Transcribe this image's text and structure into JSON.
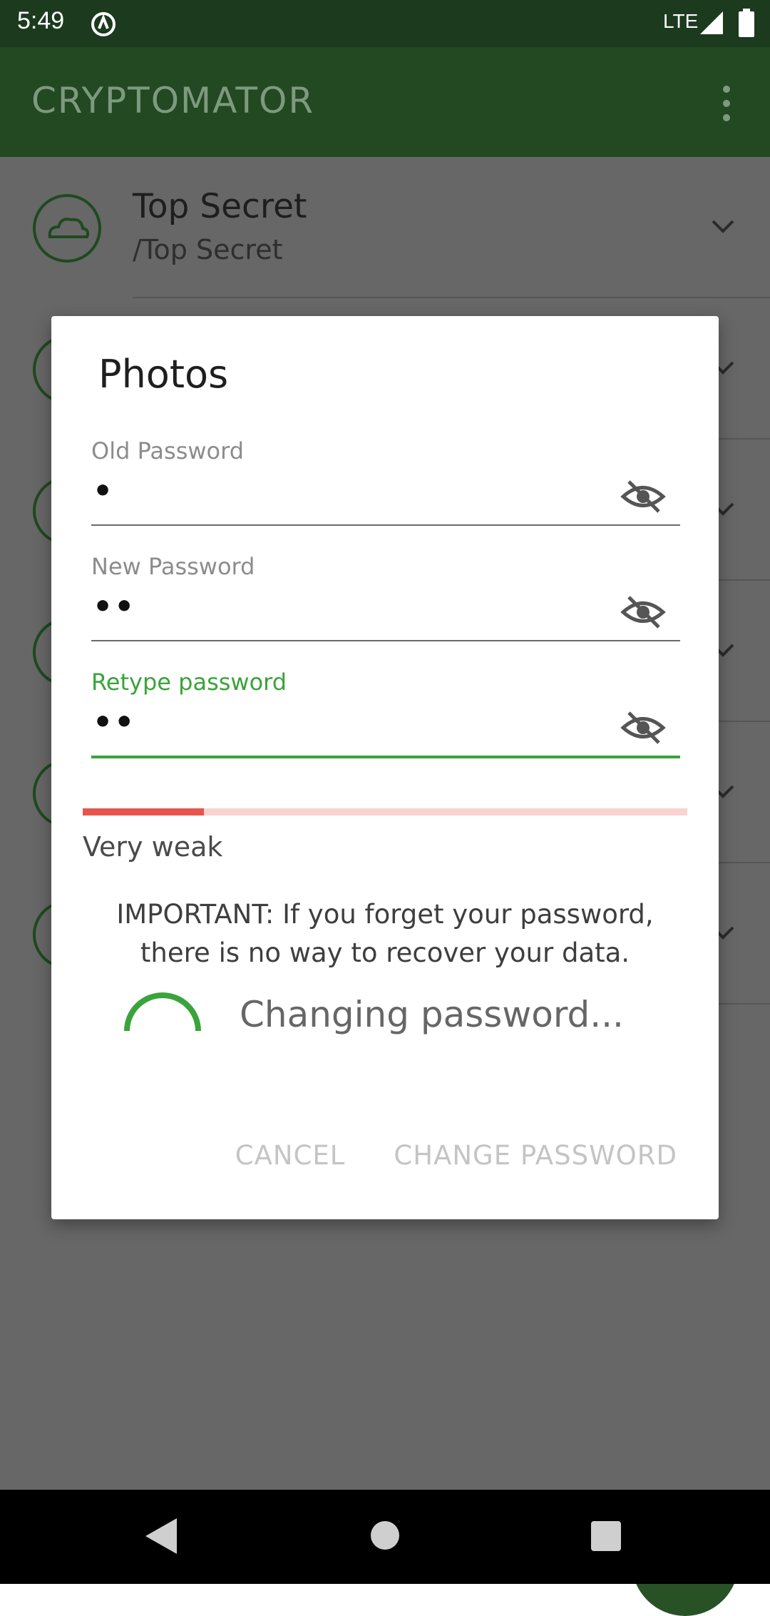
{
  "status_bar": {
    "time": "5:49",
    "network": "LTE",
    "icons": [
      "app-notification-icon",
      "signal-icon",
      "battery-icon"
    ]
  },
  "app_bar": {
    "title": "CRYPTOMATOR",
    "menu_icon": "overflow-menu-icon"
  },
  "vault_list": [
    {
      "name": "Top Secret",
      "path": "/Top Secret",
      "icon": "cloud-icon"
    },
    {
      "name": "",
      "path": "",
      "icon": "vault-icon"
    },
    {
      "name": "",
      "path": "",
      "icon": "vault-icon"
    },
    {
      "name": "",
      "path": "",
      "icon": "vault-icon"
    },
    {
      "name": "",
      "path": "",
      "icon": "vault-icon"
    },
    {
      "name": "",
      "path": "",
      "icon": "vault-icon"
    }
  ],
  "dialog": {
    "title": "Photos",
    "old_password": {
      "label": "Old Password",
      "value": "•"
    },
    "new_password": {
      "label": "New Password",
      "value": "••"
    },
    "retype_password": {
      "label": "Retype password",
      "value": "••"
    },
    "strength": {
      "label": "Very weak",
      "level": 0.2
    },
    "warning": "IMPORTANT: If you forget your password, there is no way to recover your data.",
    "progress_text": "Changing password...",
    "cancel_label": "CANCEL",
    "confirm_label": "CHANGE PASSWORD"
  },
  "colors": {
    "accent": "#3aa33a",
    "app_bar": "#224922",
    "strength_weak": "#e5554b",
    "strength_track": "#f9d3d0"
  },
  "navigation": {
    "back": "back-icon",
    "home": "home-icon",
    "recents": "recents-icon"
  }
}
